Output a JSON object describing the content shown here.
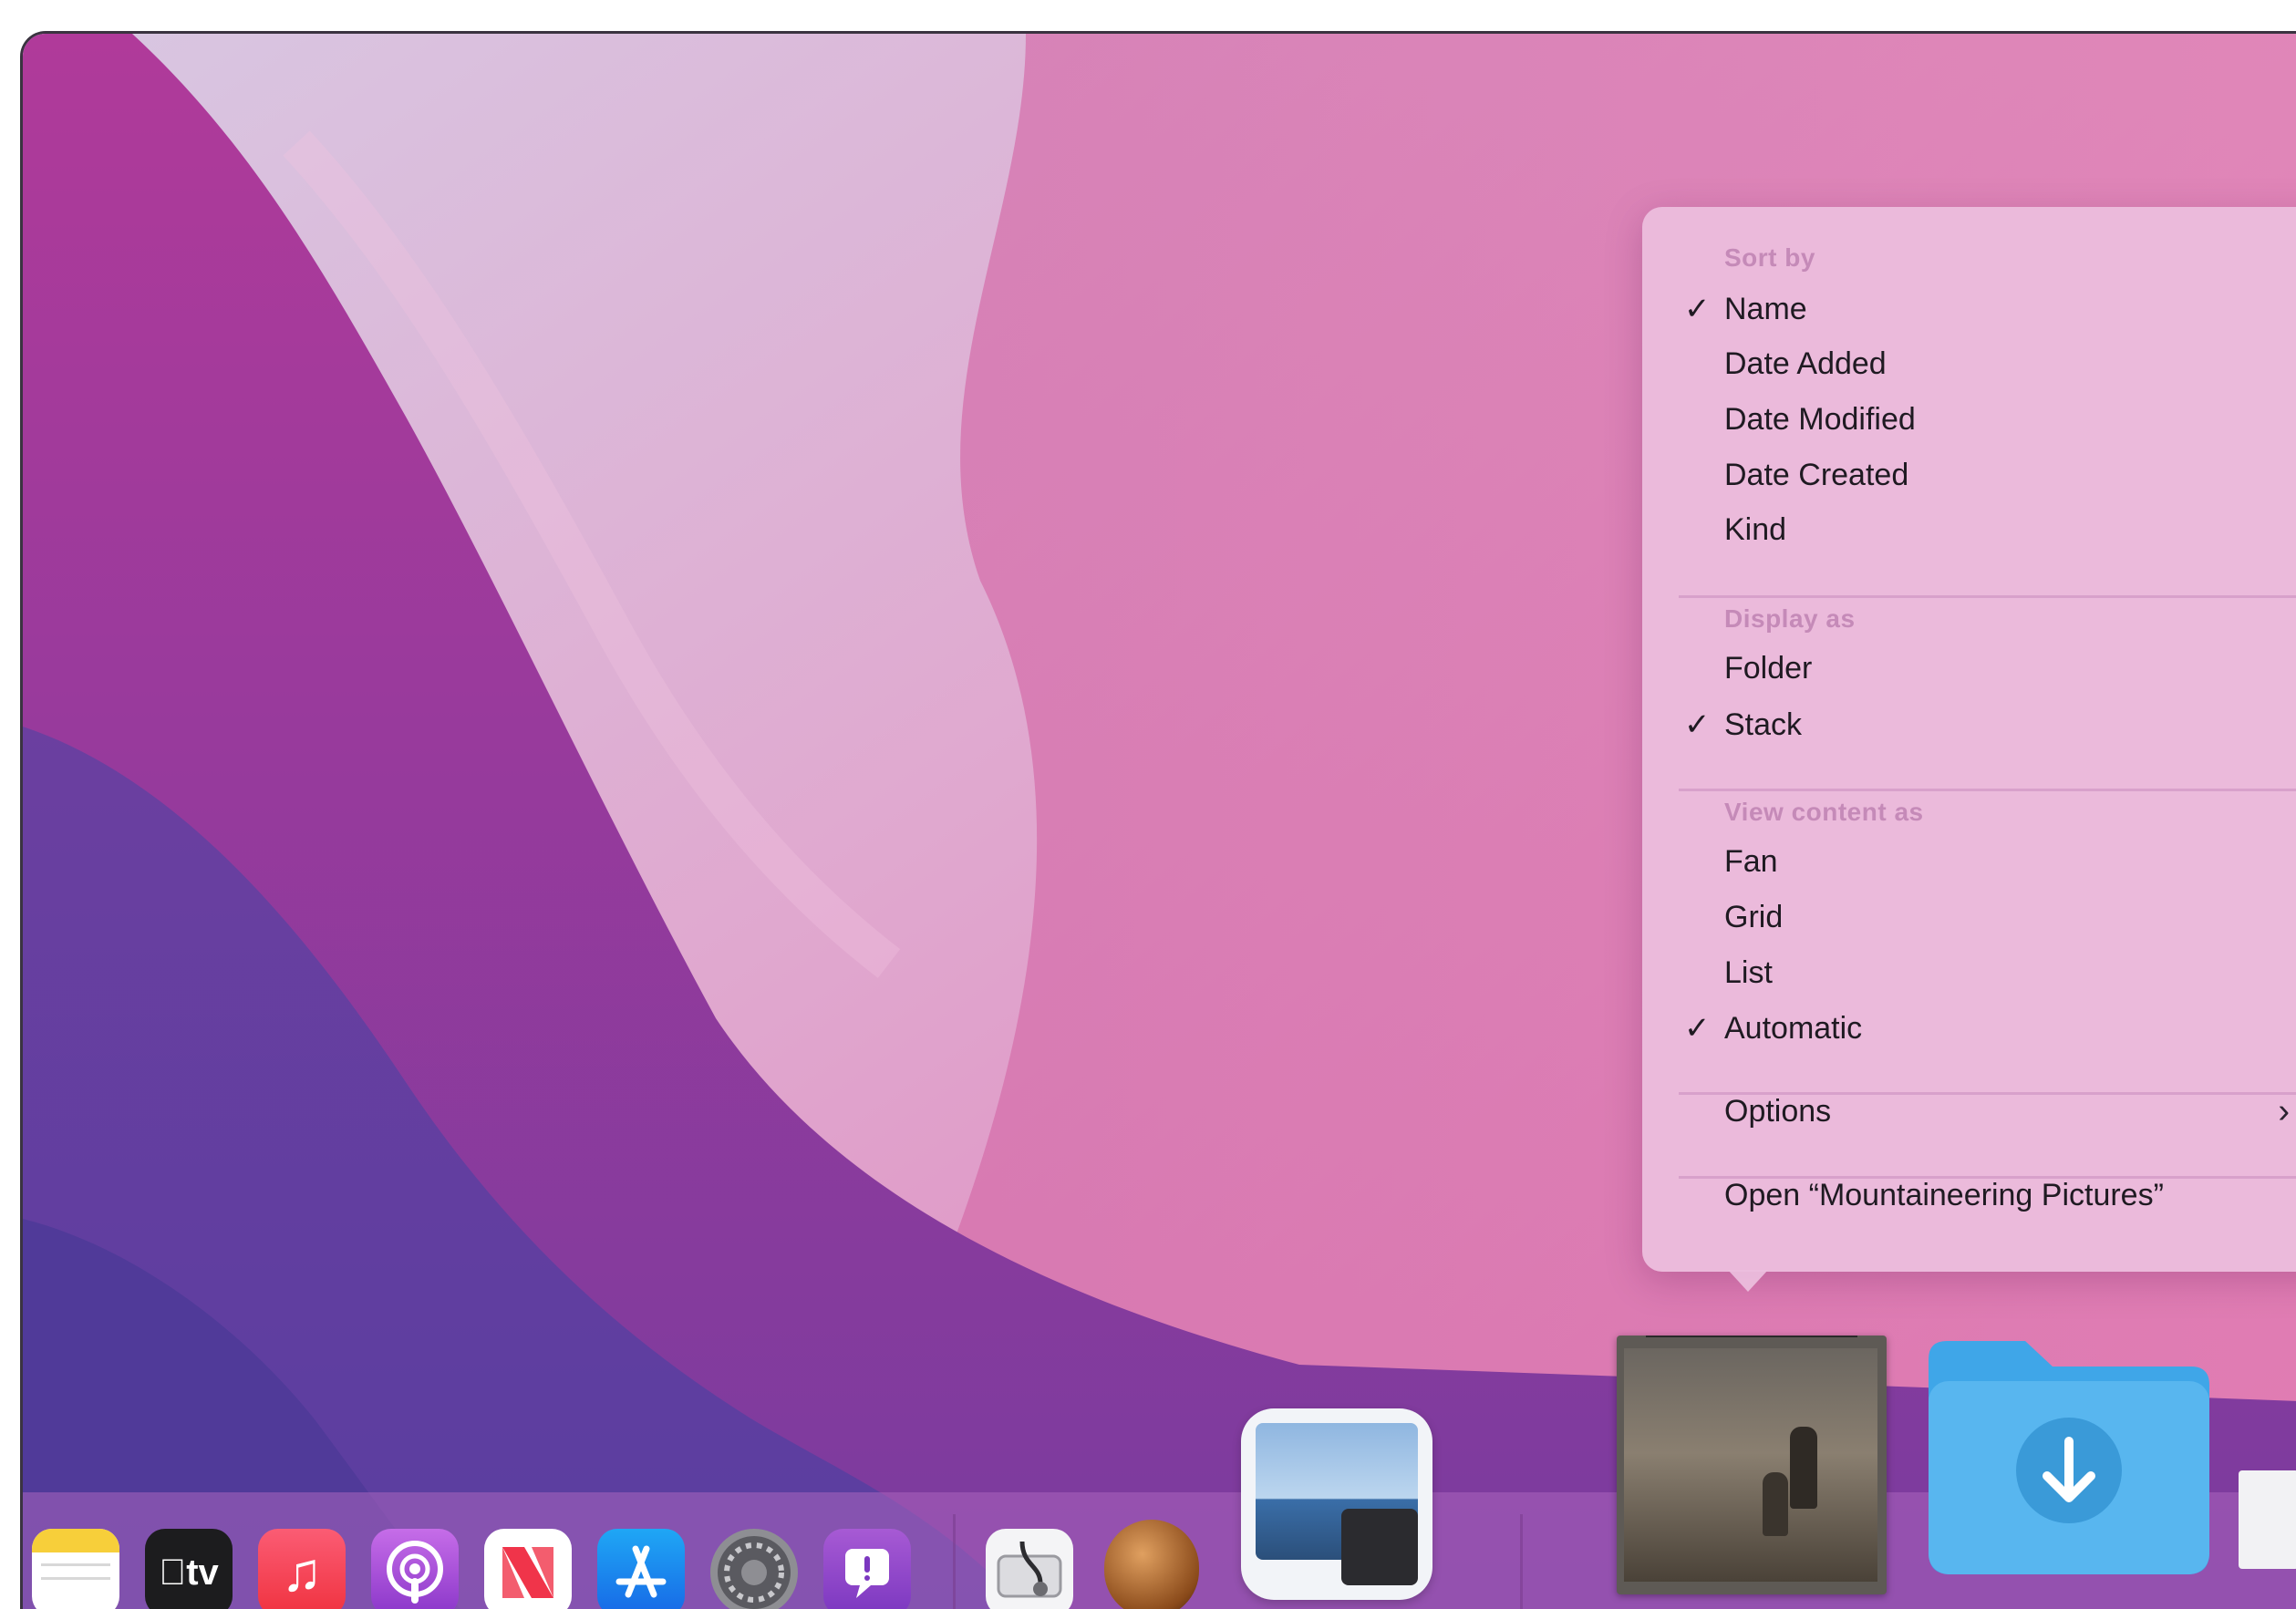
{
  "context_menu": {
    "sort_by": {
      "header": "Sort by",
      "items": [
        {
          "label": "Name",
          "checked": true
        },
        {
          "label": "Date Added",
          "checked": false
        },
        {
          "label": "Date Modified",
          "checked": false
        },
        {
          "label": "Date Created",
          "checked": false
        },
        {
          "label": "Kind",
          "checked": false
        }
      ]
    },
    "display_as": {
      "header": "Display as",
      "items": [
        {
          "label": "Folder",
          "checked": false
        },
        {
          "label": "Stack",
          "checked": true
        }
      ]
    },
    "view_content_as": {
      "header": "View content as",
      "items": [
        {
          "label": "Fan",
          "checked": false
        },
        {
          "label": "Grid",
          "checked": false
        },
        {
          "label": "List",
          "checked": false
        },
        {
          "label": "Automatic",
          "checked": true
        }
      ]
    },
    "options_label": "Options",
    "open_label": "Open “Mountaineering Pictures”",
    "check_glyph": "✓",
    "chevron_glyph": "›"
  },
  "dock": {
    "apps": [
      {
        "name": "notes-icon"
      },
      {
        "name": "apple-tv-icon",
        "label": "tv"
      },
      {
        "name": "music-icon"
      },
      {
        "name": "podcasts-icon"
      },
      {
        "name": "news-icon"
      },
      {
        "name": "app-store-icon"
      },
      {
        "name": "system-preferences-icon"
      },
      {
        "name": "feedback-assistant-icon"
      },
      {
        "name": "disk-utility-icon"
      },
      {
        "name": "cocoa-app-icon"
      },
      {
        "name": "preview-icon"
      }
    ],
    "stacks": [
      {
        "name": "mountaineering-pictures-stack"
      },
      {
        "name": "downloads-folder-icon"
      }
    ]
  },
  "colors": {
    "menu_bg": "#ecbede",
    "section_header": "#c58ab8",
    "text": "#1f1a22"
  }
}
